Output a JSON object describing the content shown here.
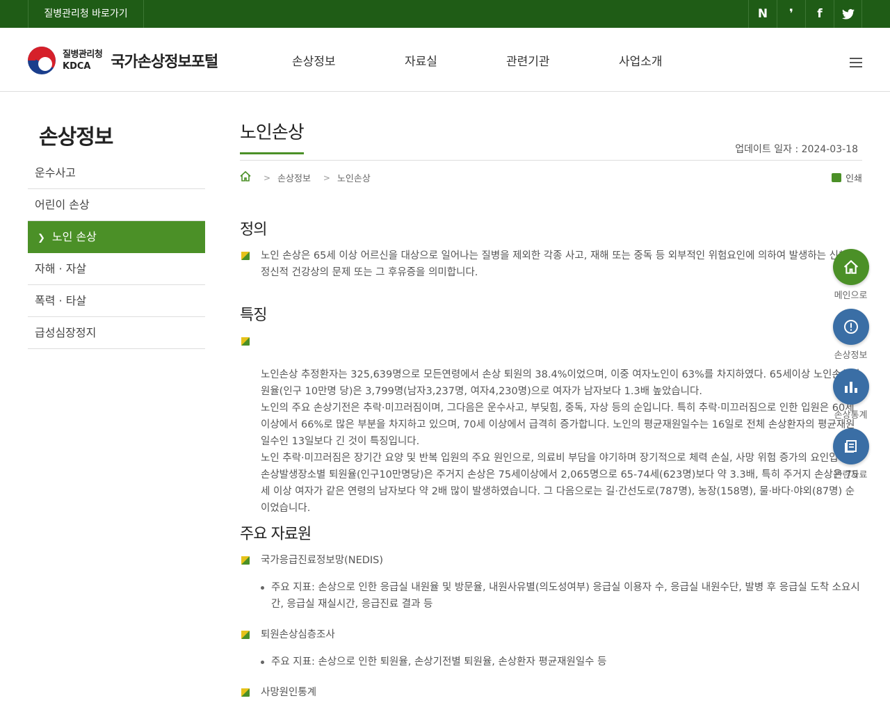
{
  "topbar": {
    "kdca_link": "질병관리청 바로가기",
    "sns": [
      {
        "glyph": "N",
        "icon": "naver-blog-icon"
      },
      {
        "glyph": "❜",
        "icon": "kakao-story-icon"
      },
      {
        "glyph": "f",
        "icon": "facebook-icon"
      },
      {
        "glyph": "🐦",
        "icon": "twitter-icon"
      }
    ]
  },
  "header": {
    "logo_ko": "질병관리청",
    "logo_en": "KDCA",
    "portal_name": "국가손상정보포털",
    "gnb": [
      "손상정보",
      "자료실",
      "관련기관",
      "사업소개"
    ]
  },
  "sidebar": {
    "title": "손상정보",
    "items": [
      "운수사고",
      "어린이 손상",
      "노인 손상",
      "자해 · 자살",
      "폭력 · 타살",
      "급성심장정지"
    ],
    "active_index": 2
  },
  "content": {
    "title": "노인손상",
    "update_label": "업데이트 일자 : 2024-03-18",
    "breadcrumb": [
      "손상정보",
      "노인손상"
    ],
    "print_label": "인쇄",
    "sections": {
      "definition": {
        "title": "정의",
        "text": "노인 손상은 65세 이상 어르신을 대상으로 일어나는 질병을 제외한 각종 사고, 재해 또는 중독 등 외부적인 위험요인에 의하여 발생하는 신체적.정신적 건강상의 문제 또는 그 후유증을 의미합니다."
      },
      "features": {
        "title": "특징",
        "text": "노인손상 추정환자는 325,639명으로 모든연령에서 손상 퇴원의 38.4%이었으며, 이중 여자노인이 63%를 차지하였다. 65세이상 노인손상퇴원율(인구 10만명 당)은 3,799명(남자3,237명, 여자4,230명)으로 여자가 남자보다 1.3배 높았습니다.\n노인의 주요 손상기전은 추락·미끄러짐이며, 그다음은 운수사고, 부딪힘, 중독, 자상 등의 순입니다. 특히 추락·미끄러짐으로 인한 입원은 60세 이상에서 66%로 많은 부분을 차지하고 있으며, 70세 이상에서 급격히 증가합니다. 노인의 평균재원일수는 16일로 전체 손상환자의 평균재원일수인 13일보다 긴 것이 특징입니다.\n노인 추락·미끄러짐은 장기간 요양 및 반복 입원의 주요 원인으로, 의료비 부담을 야기하며 장기적으로 체력 손실, 사망 위험 증가의 요인입니다.\n손상발생장소별 퇴원율(인구10만명당)은 주거지 손상은 75세이상에서 2,065명으로 65-74세(623명)보다 약 3.3배, 특히 주거지 손상은 75세 이상 여자가 같은 연령의 남자보다 약 2배 많이 발생하였습니다. 그 다음으로는 길·간선도로(787명), 농장(158명), 물·바다·야외(87명) 순이었습니다."
      },
      "sources": {
        "title": "주요 자료원",
        "items": [
          {
            "name": "국가응급진료정보망(NEDIS)",
            "detail": "주요 지표: 손상으로 인한 응급실 내원율 및 방문율, 내원사유별(의도성여부) 응급실 이용자 수, 응급실 내원수단, 발병 후 응급실 도착 소요시간, 응급실 재실시간, 응급진료 결과 등"
          },
          {
            "name": "퇴원손상심층조사",
            "detail": "주요 지표: 손상으로 인한 퇴원율, 손상기전별 퇴원율, 손상환자 평균재원일수 등"
          },
          {
            "name": "사망원인통계",
            "detail": ""
          }
        ]
      }
    }
  },
  "quick_menu": [
    {
      "label": "메인으로",
      "icon": "home-icon",
      "glyph": "⌂",
      "color": "#4b9027"
    },
    {
      "label": "손상정보",
      "icon": "info-icon",
      "glyph": "!",
      "color": "#3a6ea5"
    },
    {
      "label": "손상통계",
      "icon": "bar-chart-icon",
      "glyph": "▮",
      "color": "#3a6ea5"
    },
    {
      "label": "관련자료",
      "icon": "document-icon",
      "glyph": "▤",
      "color": "#3a6ea5"
    }
  ]
}
